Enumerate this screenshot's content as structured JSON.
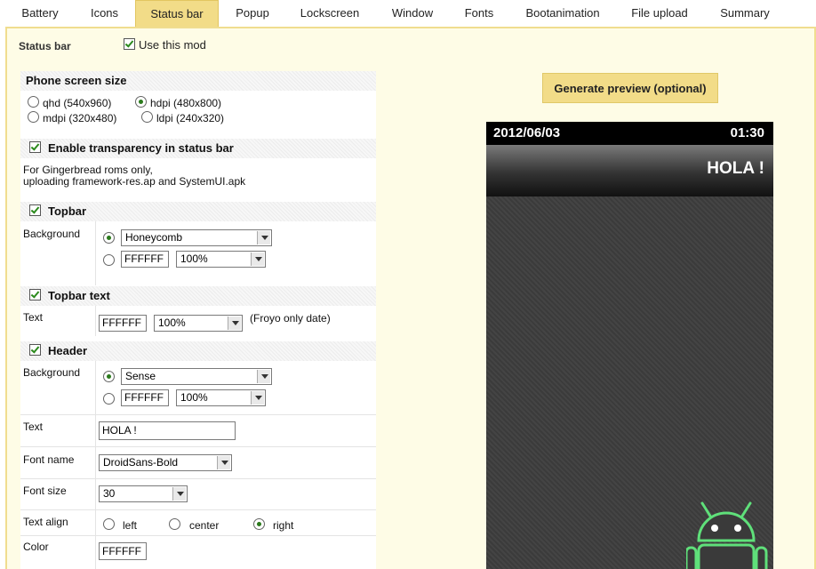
{
  "tabs": [
    {
      "label": "Battery"
    },
    {
      "label": "Icons"
    },
    {
      "label": "Status bar",
      "active": true
    },
    {
      "label": "Popup"
    },
    {
      "label": "Lockscreen"
    },
    {
      "label": "Window"
    },
    {
      "label": "Fonts"
    },
    {
      "label": "Bootanimation"
    },
    {
      "label": "File upload"
    },
    {
      "label": "Summary"
    }
  ],
  "page": {
    "title": "Status bar",
    "use_mod_label": "Use this mod",
    "use_mod_checked": true
  },
  "phone_size": {
    "heading": "Phone screen size",
    "options": [
      {
        "label": "qhd (540x960)",
        "checked": false
      },
      {
        "label": "hdpi (480x800)",
        "checked": true
      },
      {
        "label": "mdpi (320x480)",
        "checked": false
      },
      {
        "label": "ldpi (240x320)",
        "checked": false
      }
    ]
  },
  "transparency": {
    "heading": "Enable transparency in status bar",
    "checked": true,
    "note_line1": "For Gingerbread roms only,",
    "note_line2": "uploading framework-res.ap and SystemUI.apk"
  },
  "topbar": {
    "heading": "Topbar",
    "checked": true,
    "background_label": "Background",
    "theme_value": "Honeycomb",
    "color_value": "FFFFFF",
    "opacity_value": "100%"
  },
  "topbar_text": {
    "heading": "Topbar text",
    "checked": true,
    "text_label": "Text",
    "color_value": "FFFFFF",
    "opacity_value": "100%",
    "note": "(Froyo only date)"
  },
  "header": {
    "heading": "Header",
    "checked": true,
    "background_label": "Background",
    "theme_value": "Sense",
    "color_value": "FFFFFF",
    "opacity_value": "100%",
    "text_label": "Text",
    "text_value": "HOLA !",
    "font_name_label": "Font name",
    "font_name_value": "DroidSans-Bold",
    "font_size_label": "Font size",
    "font_size_value": "30",
    "text_align_label": "Text align",
    "align_options": [
      {
        "label": "left",
        "checked": false
      },
      {
        "label": "center",
        "checked": false
      },
      {
        "label": "right",
        "checked": true
      }
    ],
    "color_label": "Color",
    "color_text_value": "FFFFFF"
  },
  "preview": {
    "button_label": "Generate preview (optional)",
    "date": "2012/06/03",
    "time": "01:30",
    "header_text": "HOLA !"
  }
}
